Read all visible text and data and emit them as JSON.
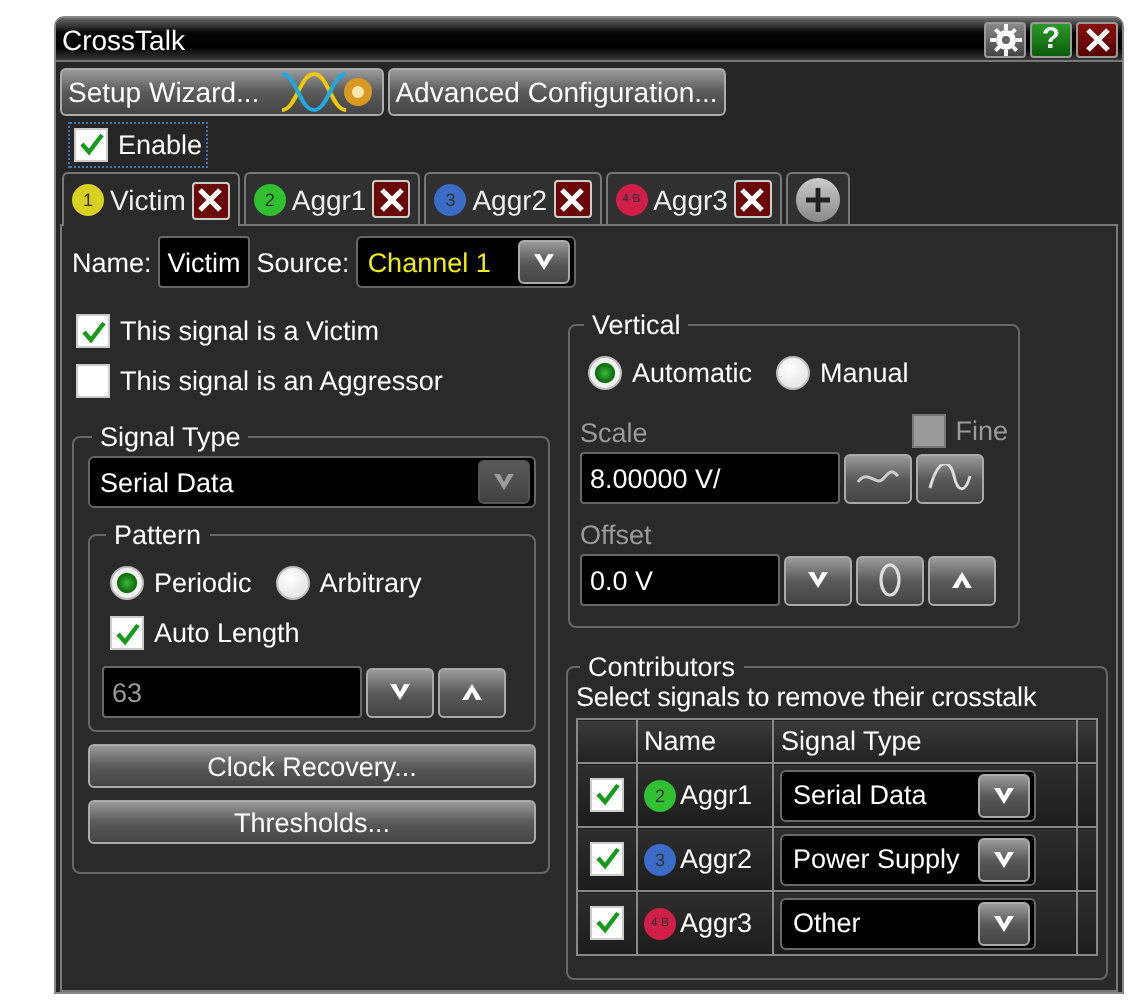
{
  "window": {
    "title": "CrossTalk"
  },
  "title_buttons": [
    {
      "kind": "settings"
    },
    {
      "kind": "help",
      "label": "?"
    },
    {
      "kind": "close"
    }
  ],
  "toolbar": {
    "setup_wizard": "Setup Wizard...",
    "advanced_configuration": "Advanced Configuration..."
  },
  "enable": {
    "label": "Enable",
    "checked": true
  },
  "tabs": [
    {
      "badge": "1",
      "label": "Victim",
      "color": "#d8d020",
      "selected": true
    },
    {
      "badge": "2",
      "label": "Aggr1",
      "color": "#30c030",
      "selected": false
    },
    {
      "badge": "3",
      "label": "Aggr2",
      "color": "#3a6cc8",
      "selected": false
    },
    {
      "badge": "4 B",
      "label": "Aggr3",
      "color": "#d0204a",
      "selected": false
    }
  ],
  "name": {
    "label": "Name:",
    "value": "Victim"
  },
  "source": {
    "label": "Source:",
    "value": "Channel 1"
  },
  "role_checks": [
    {
      "label": "This signal is a Victim",
      "checked": true
    },
    {
      "label": "This signal is an Aggressor",
      "checked": false
    }
  ],
  "signal_type": {
    "title": "Signal Type",
    "value": "Serial Data",
    "disabled": true
  },
  "pattern": {
    "title": "Pattern",
    "options": [
      {
        "label": "Periodic",
        "selected": true
      },
      {
        "label": "Arbitrary",
        "selected": false
      }
    ],
    "auto_length": {
      "label": "Auto Length",
      "checked": true
    },
    "length": {
      "value": "63",
      "disabled": true
    }
  },
  "buttons": [
    "Clock Recovery...",
    "Thresholds..."
  ],
  "vertical": {
    "title": "Vertical",
    "modes": [
      {
        "label": "Automatic",
        "selected": true
      },
      {
        "label": "Manual",
        "selected": false
      }
    ],
    "fine": {
      "label": "Fine",
      "checked": false,
      "disabled": true
    },
    "scale": {
      "label": "Scale",
      "value": "8.00000 V/",
      "disabled": true
    },
    "offset": {
      "label": "Offset",
      "value": "0.0 V",
      "disabled": true
    }
  },
  "contributors": {
    "title": "Contributors",
    "hint": "Select signals to remove their crosstalk",
    "columns": [
      "Name",
      "Signal Type"
    ],
    "rows": [
      {
        "checked": true,
        "badge": "2",
        "color": "#30c030",
        "name": "Aggr1",
        "signal_type": "Serial Data"
      },
      {
        "checked": true,
        "badge": "3",
        "color": "#3a6cc8",
        "name": "Aggr2",
        "signal_type": "Power Supply"
      },
      {
        "checked": true,
        "badge": "4 B",
        "color": "#d0204a",
        "name": "Aggr3",
        "signal_type": "Other"
      }
    ]
  }
}
